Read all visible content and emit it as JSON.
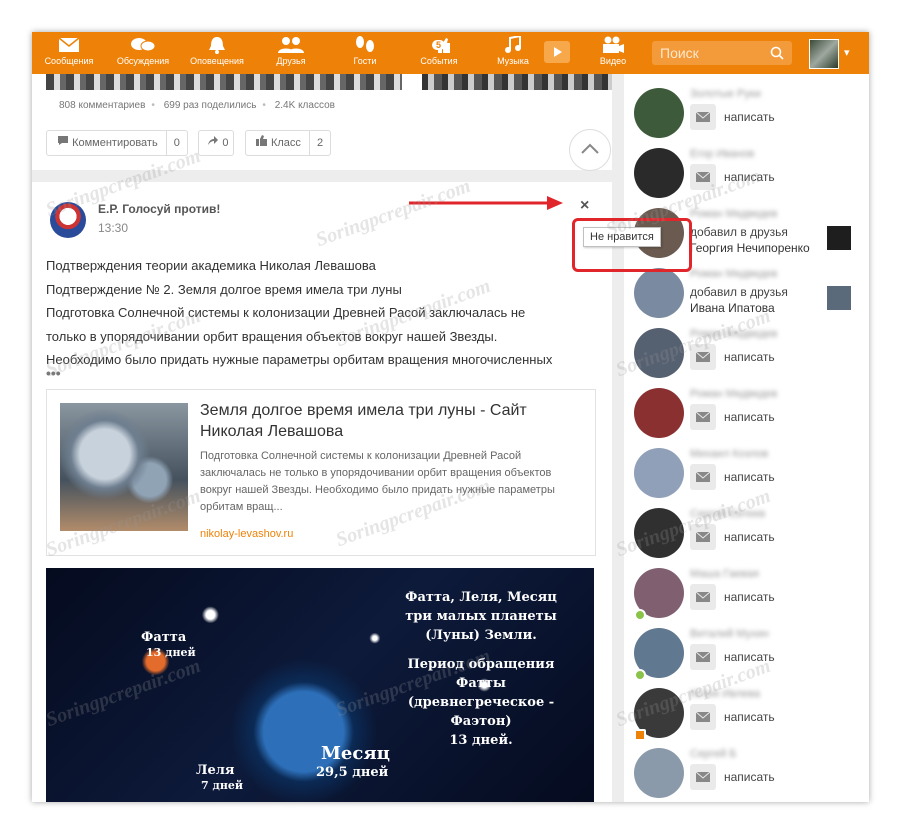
{
  "topbar": {
    "nav": [
      {
        "label": "Сообщения",
        "icon": "envelope-icon"
      },
      {
        "label": "Обсуждения",
        "icon": "chat-bubbles-icon"
      },
      {
        "label": "Оповещения",
        "icon": "bell-icon"
      },
      {
        "label": "Друзья",
        "icon": "people-icon"
      },
      {
        "label": "Гости",
        "icon": "footprints-icon"
      },
      {
        "label": "События",
        "icon": "thumbs-up-icon",
        "badge": "5"
      },
      {
        "label": "Музыка",
        "icon": "music-note-icon"
      },
      {
        "label": "Видео",
        "icon": "video-camera-icon"
      }
    ],
    "search_placeholder": "Поиск",
    "caret": "▾"
  },
  "post1": {
    "comments": "808 комментариев",
    "shares": "699 раз поделились",
    "likes": "2.4K классов",
    "comment_btn": "Комментировать",
    "comment_count": "0",
    "share_count": "0",
    "like_btn": "Класс",
    "like_count": "2"
  },
  "post2": {
    "group": "Е.Р. Голосуй против!",
    "time": "13:30",
    "close": "×",
    "lines": [
      "Подтверждения теории академика Николая Левашова",
      "Подтверждение № 2. Земля долгое время имела три луны",
      "Подготовка Солнечной системы к колонизации Древней Расой заключалась не",
      "только в упорядочивании орбит вращения объектов вокруг нашей Звезды.",
      "Необходимо было придать нужные параметры орбитам вращения многочисленных"
    ],
    "more": "•••",
    "link": {
      "title": "Земля долгое время имела три луны - Сайт Николая Левашова",
      "desc": "Подготовка Солнечной системы к колонизации Древней Расой заключалась не только в упорядочивании орбит вращения объектов вокруг нашей Звезды. Необходимо было придать нужные параметры орбитам вращ...",
      "url": "nikolay-levashov.ru"
    },
    "image": {
      "text1": "Фатта, Леля, Месяц",
      "text2": "три малых планеты",
      "text3": "(Луны) Земли.",
      "text4": "Период обращения",
      "text5": "Фатты",
      "text6": "(древнегреческое -",
      "text7": "Фаэтон)",
      "text8": "13 дней.",
      "fatta": "Фатта",
      "fatta_days": "13 дней",
      "lelya": "Леля",
      "lelya_days": "7 дней",
      "mesyats": "Месяц",
      "mesyats_days": "29,5 дней"
    }
  },
  "tooltip": "Не нравится",
  "sidebar": {
    "write_label": "написать",
    "friends": [
      {
        "name": "Золотые Руки",
        "action": "",
        "target": "",
        "avatar": "#3d5a3a"
      },
      {
        "name": "Егор Иванов",
        "action": "",
        "target": "",
        "avatar": "#2a2a2a"
      },
      {
        "name": "Роман Медведев",
        "action": "добавил в друзья",
        "target": "Георгия Нечипоренко",
        "avatar": "#6a5a50"
      },
      {
        "name": "Роман Медведев",
        "action": "добавил в друзья",
        "target": "Ивана Ипатова",
        "avatar": "#7a8aa0"
      },
      {
        "name": "Роман Медведев",
        "action": "",
        "target": "",
        "avatar": "#556070"
      },
      {
        "name": "Роман Медведев",
        "action": "",
        "target": "",
        "avatar": "#8a3030"
      },
      {
        "name": "Михаил Козлов",
        "action": "",
        "target": "",
        "avatar": "#90a0b8"
      },
      {
        "name": "Сергей Евтеев",
        "action": "",
        "target": "",
        "avatar": "#303030"
      },
      {
        "name": "Маша Гаевая",
        "action": "",
        "target": "",
        "avatar": "#806070"
      },
      {
        "name": "Виталий Мухин",
        "action": "",
        "target": "",
        "avatar": "#607890"
      },
      {
        "name": "Юлия Ивлева",
        "action": "",
        "target": "",
        "avatar": "#3a3a3a"
      },
      {
        "name": "Сергей Б",
        "action": "",
        "target": "",
        "avatar": "#8a9aaa"
      }
    ]
  },
  "watermark": "Soringpcrepair.com"
}
